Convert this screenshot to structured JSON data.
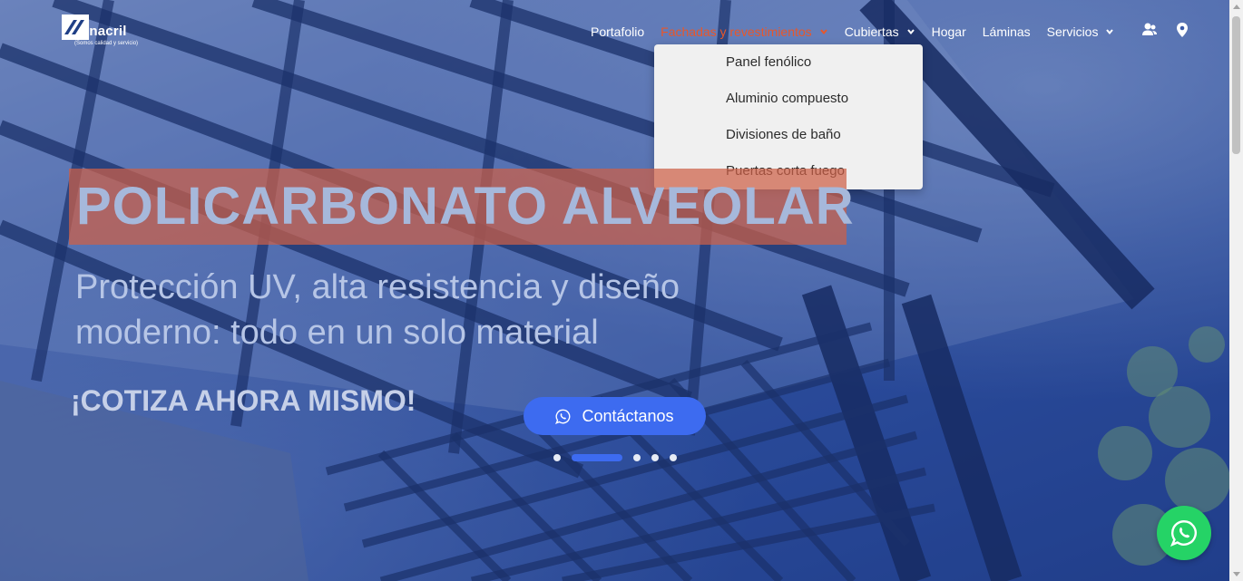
{
  "brand": {
    "logo_word": "inacril",
    "tagline": "(Somos calidad y servicio)"
  },
  "nav": {
    "items": [
      {
        "label": "Portafolio",
        "has_dropdown": false
      },
      {
        "label": "Fachadas y revestimientos",
        "has_dropdown": true,
        "active": true
      },
      {
        "label": "Cubiertas",
        "has_dropdown": true
      },
      {
        "label": "Hogar",
        "has_dropdown": false
      },
      {
        "label": "Láminas",
        "has_dropdown": false
      },
      {
        "label": "Servicios",
        "has_dropdown": true
      }
    ],
    "icons": [
      "users-icon",
      "location-pin-icon"
    ]
  },
  "dropdown": {
    "items": [
      "Panel fenólico",
      "Aluminio compuesto",
      "Divisiones de baño",
      "Puertas corta fuego"
    ]
  },
  "hero": {
    "headline": "POLICARBONATO ALVEOLAR",
    "subtitle": "Protección UV, alta resistencia y diseño moderno: todo en un solo material",
    "cta_text": "¡COTIZA AHORA MISMO!",
    "contact_button": "Contáctanos"
  },
  "slider": {
    "slide_count": 5,
    "active_index": 1
  },
  "colors": {
    "accent_blue": "#3d6bf0",
    "active_nav": "#e8572a",
    "whatsapp_green": "#25d366",
    "headline_bg": "#cd5f46"
  }
}
